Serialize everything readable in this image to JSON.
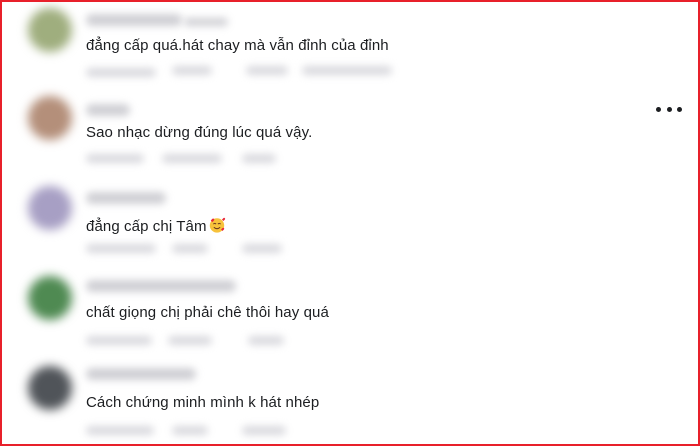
{
  "comments": [
    {
      "text": "đẳng cấp quá.hát chay mà vẫn đỉnh của đỉnh",
      "avatar_color": "#9fae7e"
    },
    {
      "text": "Sao nhạc dừng đúng lúc quá vậy.",
      "avatar_color": "#b48f7a"
    },
    {
      "text": "đẳng cấp chị Tâm",
      "emoji": "smiling-face-with-hearts",
      "avatar_color": "#a79fc4"
    },
    {
      "text": "chất giọng chị phải chê thôi hay quá",
      "avatar_color": "#4f8a52"
    },
    {
      "text": "Cách chứng minh mình k hát nhép",
      "avatar_color": "#505459"
    }
  ],
  "more_icon": "more-options-icon",
  "colors": {
    "frame_border": "#e8202a",
    "text": "#1c1e21"
  }
}
